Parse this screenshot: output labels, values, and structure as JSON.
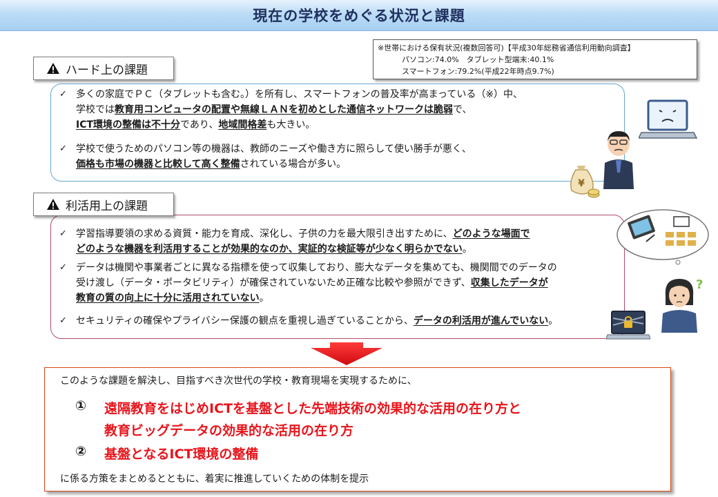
{
  "title": "現在の学校をめぐる状況と課題",
  "source_note": {
    "line1": "※世帯における保有状況(複数回答可)【平成30年総務省通信利用動向調査】",
    "line2": "パソコン:74.0%　タブレット型端末:40.1%",
    "line3": "スマートフォン:79.2%(平成22年時点9.7%)"
  },
  "sections": {
    "hard": {
      "heading": "ハード上の課題",
      "item1": {
        "l1": "多くの家庭でＰＣ（タブレットも含む。）を所有し、スマートフォンの普及率が高まっている（※）中、",
        "l2a": "学校では",
        "l2b": "教育用コンピュータの配置や無線ＬＡＮを初めとした通信ネットワークは脆弱",
        "l2c": "で、",
        "l3a": "ICT環境の整備は不十分",
        "l3b": "であり、",
        "l3c": "地域間格差",
        "l3d": "も大きい。"
      },
      "item2": {
        "l1": "学校で使うためのパソコン等の機器は、教師のニーズや働き方に照らして使い勝手が悪く、",
        "l2a": "価格も市場の機器と比較して高く整備",
        "l2b": "されている場合が多い。"
      }
    },
    "use": {
      "heading": "利活用上の課題",
      "item1": {
        "l1a": "学習指導要領の求める資質・能力を育成、深化し、子供の力を最大限引き出すために、",
        "l1b": "どのような場面で",
        "l2a": "どのような機器を利活用することが効果的なのか、実証的な検証等が少なく明らかでない",
        "l2b": "。"
      },
      "item2": {
        "l1": "データは機関や事業者ごとに異なる指標を使って収集しており、膨大なデータを集めても、機関間でのデータの",
        "l2a": "受け渡し（データ・ポータビリティ）が確保されていないため正確な比較や参照ができず、",
        "l2b": "収集したデータが",
        "l3a": "教育の質の向上に十分に活用されていない",
        "l3b": "。"
      },
      "item3": {
        "l1a": "セキュリティの確保やプライバシー保護の観点を重視し過ぎていることから、",
        "l1b": "データの利活用が進んでいない",
        "l1c": "。"
      }
    }
  },
  "conclusion": {
    "intro": "このような課題を解決し、目指すべき次世代の学校・教育現場を実現するために、",
    "point1_num": "①",
    "point1_l1": "遠隔教育をはじめICTを基盤とした先端技術の効果的な活用の在り方と",
    "point1_l2": "教育ビッグデータの効果的な活用の在り方",
    "point2_num": "②",
    "point2": "基盤となるICT環境の整備",
    "outro": "に係る方策をまとめるとともに、着実に推進していくための体制を提示"
  },
  "colors": {
    "title_text": "#1f2f5e",
    "hard_border": "#62a6d1",
    "use_border": "#b04a6a",
    "conclusion_border": "#d64515",
    "emphasis_red": "#e8141b",
    "arrow_red": "#e8141b"
  },
  "icons": [
    "warning-icon",
    "checkmark-icon",
    "laptop-icon",
    "money-bag-icon",
    "tablet-icon",
    "lock-icon"
  ]
}
